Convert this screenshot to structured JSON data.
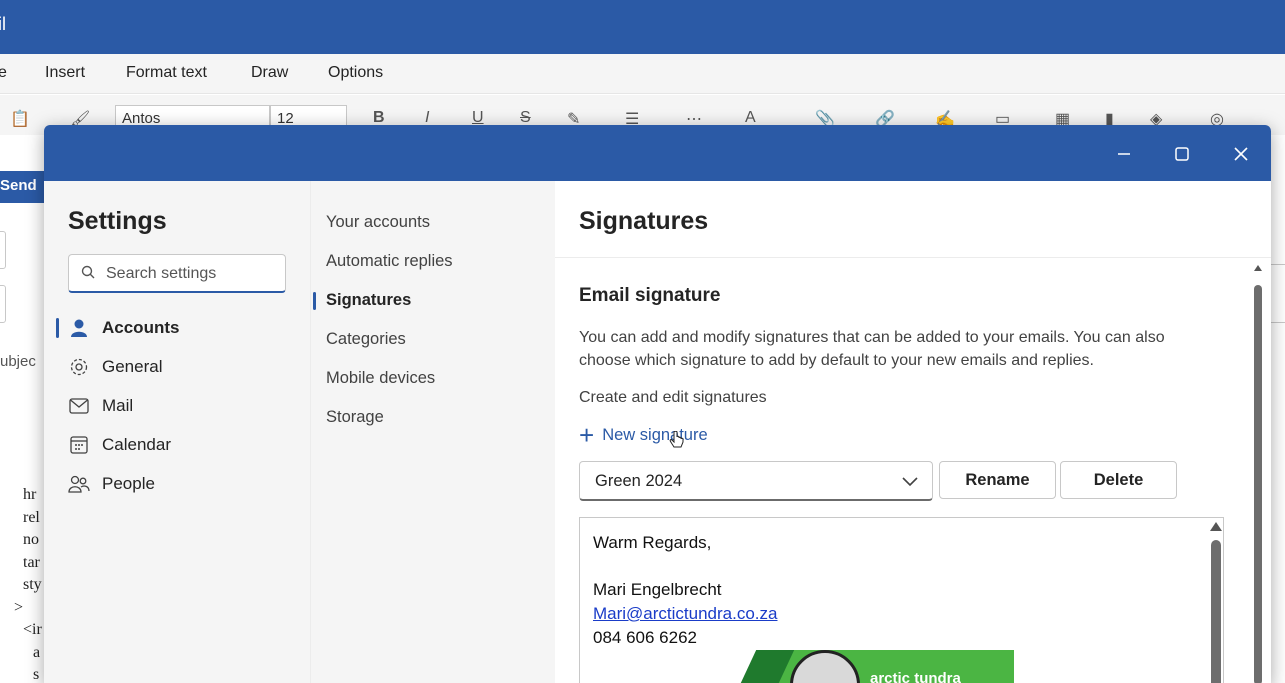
{
  "app": {
    "title_fragment": "il",
    "tabs": [
      "e",
      "Insert",
      "Format text",
      "Draw",
      "Options"
    ],
    "font_name": "Antos",
    "font_size": "12",
    "send_label": "Send",
    "subject_fragment": "ubjec",
    "code_lines": [
      "hr",
      "rel",
      "no",
      "tar",
      "sty",
      ">",
      "<ir",
      "a",
      "s"
    ]
  },
  "dialog": {
    "window_controls": [
      "minimize-icon",
      "maximize-icon",
      "close-icon"
    ],
    "nav": {
      "title": "Settings",
      "search_placeholder": "Search settings",
      "items": [
        {
          "label": "Accounts",
          "icon": "person-icon",
          "selected": true
        },
        {
          "label": "General",
          "icon": "gear-icon",
          "selected": false
        },
        {
          "label": "Mail",
          "icon": "mail-icon",
          "selected": false
        },
        {
          "label": "Calendar",
          "icon": "calendar-icon",
          "selected": false
        },
        {
          "label": "People",
          "icon": "people-icon",
          "selected": false
        }
      ]
    },
    "subnav": {
      "items": [
        {
          "label": "Your accounts",
          "selected": false
        },
        {
          "label": "Automatic replies",
          "selected": false
        },
        {
          "label": "Signatures",
          "selected": true
        },
        {
          "label": "Categories",
          "selected": false
        },
        {
          "label": "Mobile devices",
          "selected": false
        },
        {
          "label": "Storage",
          "selected": false
        }
      ]
    },
    "content": {
      "title": "Signatures",
      "section_heading": "Email signature",
      "description": "You can add and modify signatures that can be added to your emails. You can also choose which signature to add by default to your new emails and replies.",
      "create_label": "Create and edit signatures",
      "new_signature_label": "New signature",
      "selected_signature": "Green 2024",
      "rename_label": "Rename",
      "delete_label": "Delete",
      "signature": {
        "greeting": "Warm Regards,",
        "name": "Mari Engelbrecht",
        "email": "Mari@arctictundra.co.za",
        "phone": "084 606 6262",
        "banner_text": "arctic tundra"
      }
    }
  },
  "colors": {
    "brand_blue": "#2b5aa6",
    "banner_green": "#4bb543",
    "link_blue": "#1a3cc8"
  }
}
